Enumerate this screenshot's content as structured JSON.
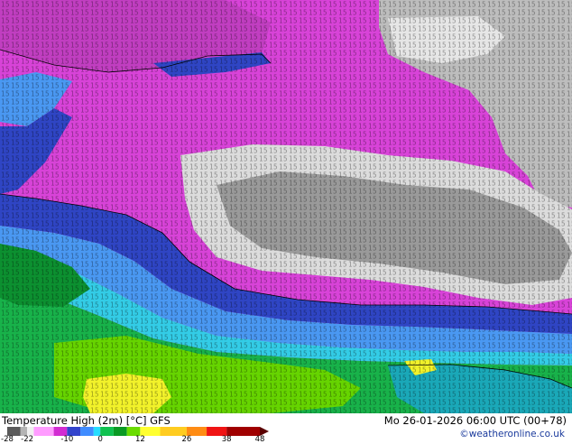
{
  "title": "Temperature High (2m) [°C] GFS",
  "datetime": "Mo 26-01-2026 06:00 UTC (00+78)",
  "credit": "©weatheronline.co.uk",
  "legend": {
    "ticks": [
      "-28",
      "-22",
      "-10",
      "0",
      "12",
      "26",
      "38",
      "48"
    ],
    "tick_values": [
      -28,
      -22,
      -10,
      0,
      12,
      26,
      38,
      48
    ],
    "range": [
      -28,
      48
    ],
    "colors": [
      {
        "value": -28,
        "color": "#5a5a5a"
      },
      {
        "value": -24,
        "color": "#b4b4b4"
      },
      {
        "value": -22,
        "color": "#f0f0f0"
      },
      {
        "value": -20,
        "color": "#ff9cff"
      },
      {
        "value": -14,
        "color": "#d22cd2"
      },
      {
        "value": -10,
        "color": "#3344cc"
      },
      {
        "value": -6,
        "color": "#3f8cff"
      },
      {
        "value": -2,
        "color": "#26dcff"
      },
      {
        "value": 0,
        "color": "#10c250"
      },
      {
        "value": 4,
        "color": "#0a9a24"
      },
      {
        "value": 8,
        "color": "#6adc00"
      },
      {
        "value": 12,
        "color": "#ffff30"
      },
      {
        "value": 18,
        "color": "#ffcc20"
      },
      {
        "value": 26,
        "color": "#ff8c14"
      },
      {
        "value": 32,
        "color": "#f01414"
      },
      {
        "value": 38,
        "color": "#a00000"
      },
      {
        "value": 48,
        "color": "#5a0000"
      }
    ]
  },
  "regions": [
    {
      "name": "cold-core",
      "temp_c": -26,
      "color": "#9a9a9a"
    },
    {
      "name": "cold-core-edge",
      "temp_c": -23,
      "color": "#dcdcdc"
    },
    {
      "name": "arctic-air",
      "temp_c": -16,
      "color": "#d843d8"
    },
    {
      "name": "front-dark",
      "temp_c": -10,
      "color": "#2f45c4"
    },
    {
      "name": "cool-band",
      "temp_c": -5,
      "color": "#4a98f2"
    },
    {
      "name": "mild-band",
      "temp_c": -1,
      "color": "#33cce6"
    },
    {
      "name": "green-south",
      "temp_c": 3,
      "color": "#18b24a"
    },
    {
      "name": "dark-green",
      "temp_c": 6,
      "color": "#0c9030"
    },
    {
      "name": "lime",
      "temp_c": 9,
      "color": "#66d400"
    },
    {
      "name": "yellow",
      "temp_c": 12,
      "color": "#f2f22a"
    },
    {
      "name": "gulf-water",
      "temp_c": 4,
      "color": "#1aa8b8"
    },
    {
      "name": "ne-cold",
      "temp_c": -24,
      "color": "#bdbdbd"
    }
  ]
}
